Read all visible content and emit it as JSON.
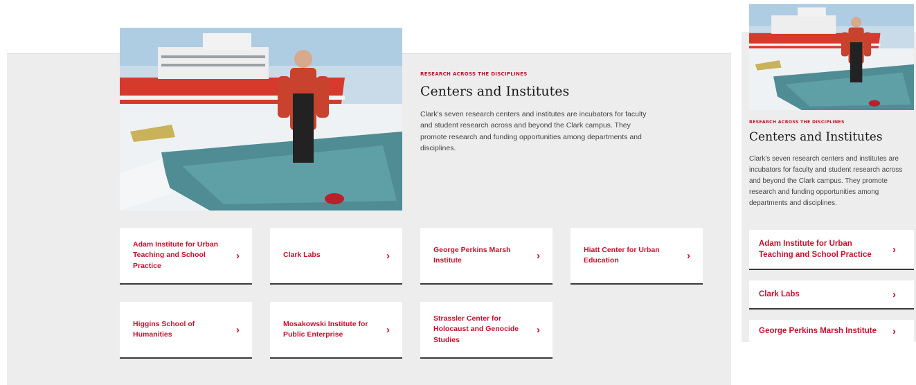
{
  "section": {
    "eyebrow": "RESEARCH ACROSS THE DISCIPLINES",
    "title": "Centers and Institutes",
    "description": "Clark's seven research centers and institutes are incubators for faculty and student research across and beyond the Clark campus. They promote research and funding opportunities among departments and disciplines."
  },
  "desktop_cards": [
    {
      "label": "Adam Institute for Urban Teaching and School Practice"
    },
    {
      "label": "Clark Labs"
    },
    {
      "label": "George Perkins Marsh Institute"
    },
    {
      "label": "Hiatt Center for Urban Education"
    },
    {
      "label": "Higgins School of Humanities"
    },
    {
      "label": "Mosakowski Institute for Public Enterprise"
    },
    {
      "label": "Strassler Center for Holocaust and Genocide Studies"
    }
  ],
  "mobile_cards": [
    {
      "label": "Adam Institute for Urban Teaching and School Practice"
    },
    {
      "label": "Clark Labs"
    },
    {
      "label": "George Perkins Marsh Institute"
    }
  ],
  "icons": {
    "card_arrow": "chevron-right-icon"
  },
  "colors": {
    "accent": "#c8102e",
    "panel_bg": "#ededed",
    "card_bg": "#ffffff",
    "card_border": "#3a3a3a"
  }
}
